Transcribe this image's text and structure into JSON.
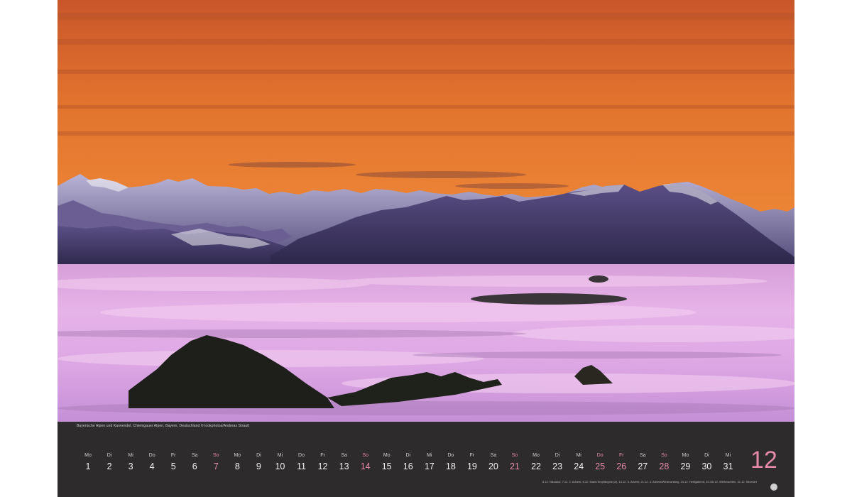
{
  "caption": "Bayerische Alpen und Karwendel, Chiemgauer Alpen, Bayern, Deutschland © lookphotos/Andreas Strauß",
  "month_number": "12",
  "holidays_note": "6.12. Nikolaus, 7.12. 2. Advent, 8.12. Mariä Empfängnis (A), 14.12. 3. Advent, 21.12. 4. Advent/Winteranfang, 24.12. Heiligabend, 25./26.12. Weihnachten, 31.12. Silvester",
  "colors": {
    "accent_pink": "#e58aa8",
    "band_dark": "#2d2b2c",
    "sky_orange": "#f0893a",
    "fog_pink": "#e8b4e4"
  },
  "days": [
    {
      "dn": "Mo",
      "dd": "1",
      "sun": false
    },
    {
      "dn": "Di",
      "dd": "2",
      "sun": false
    },
    {
      "dn": "Mi",
      "dd": "3",
      "sun": false
    },
    {
      "dn": "Do",
      "dd": "4",
      "sun": false
    },
    {
      "dn": "Fr",
      "dd": "5",
      "sun": false
    },
    {
      "dn": "Sa",
      "dd": "6",
      "sun": false
    },
    {
      "dn": "So",
      "dd": "7",
      "sun": true
    },
    {
      "dn": "Mo",
      "dd": "8",
      "sun": false
    },
    {
      "dn": "Di",
      "dd": "9",
      "sun": false
    },
    {
      "dn": "Mi",
      "dd": "10",
      "sun": false
    },
    {
      "dn": "Do",
      "dd": "11",
      "sun": false
    },
    {
      "dn": "Fr",
      "dd": "12",
      "sun": false
    },
    {
      "dn": "Sa",
      "dd": "13",
      "sun": false
    },
    {
      "dn": "So",
      "dd": "14",
      "sun": true
    },
    {
      "dn": "Mo",
      "dd": "15",
      "sun": false
    },
    {
      "dn": "Di",
      "dd": "16",
      "sun": false
    },
    {
      "dn": "Mi",
      "dd": "17",
      "sun": false
    },
    {
      "dn": "Do",
      "dd": "18",
      "sun": false
    },
    {
      "dn": "Fr",
      "dd": "19",
      "sun": false
    },
    {
      "dn": "Sa",
      "dd": "20",
      "sun": false
    },
    {
      "dn": "So",
      "dd": "21",
      "sun": true
    },
    {
      "dn": "Mo",
      "dd": "22",
      "sun": false
    },
    {
      "dn": "Di",
      "dd": "23",
      "sun": false
    },
    {
      "dn": "Mi",
      "dd": "24",
      "sun": false
    },
    {
      "dn": "Do",
      "dd": "25",
      "sun": true
    },
    {
      "dn": "Fr",
      "dd": "26",
      "sun": true
    },
    {
      "dn": "Sa",
      "dd": "27",
      "sun": false
    },
    {
      "dn": "So",
      "dd": "28",
      "sun": true
    },
    {
      "dn": "Mo",
      "dd": "29",
      "sun": false
    },
    {
      "dn": "Di",
      "dd": "30",
      "sun": false
    },
    {
      "dn": "Mi",
      "dd": "31",
      "sun": false
    }
  ]
}
